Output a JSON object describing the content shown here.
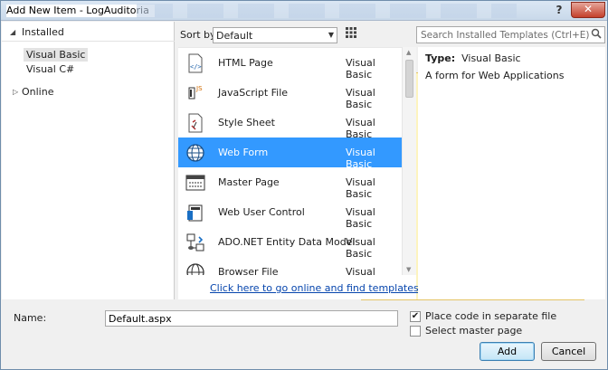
{
  "window": {
    "title": "Add New Item - LogAuditoria",
    "help_glyph": "?",
    "close_glyph": "✕"
  },
  "tree": {
    "installed_label": "Installed",
    "items": [
      {
        "label": "Visual Basic",
        "selected": true
      },
      {
        "label": "Visual C#",
        "selected": false
      }
    ],
    "online_label": "Online"
  },
  "toolbar": {
    "sort_label": "Sort by:",
    "sort_value": "Default"
  },
  "search": {
    "placeholder": "Search Installed Templates (Ctrl+E)"
  },
  "templates": [
    {
      "name": "HTML Page",
      "language": "Visual Basic",
      "icon": "html-page-icon",
      "selected": false
    },
    {
      "name": "JavaScript File",
      "language": "Visual Basic",
      "icon": "javascript-file-icon",
      "selected": false
    },
    {
      "name": "Style Sheet",
      "language": "Visual Basic",
      "icon": "style-sheet-icon",
      "selected": false
    },
    {
      "name": "Web Form",
      "language": "Visual Basic",
      "icon": "web-form-icon",
      "selected": true
    },
    {
      "name": "Master Page",
      "language": "Visual Basic",
      "icon": "master-page-icon",
      "selected": false
    },
    {
      "name": "Web User Control",
      "language": "Visual Basic",
      "icon": "web-user-control-icon",
      "selected": false
    },
    {
      "name": "ADO.NET Entity Data Model",
      "language": "Visual Basic",
      "icon": "entity-data-model-icon",
      "selected": false
    },
    {
      "name": "Browser File",
      "language": "Visual Basic",
      "icon": "browser-file-icon",
      "selected": false
    }
  ],
  "online_link": "Click here to go online and find templates.",
  "details": {
    "type_label": "Type:",
    "type_value": "Visual Basic",
    "description": "A form for Web Applications"
  },
  "bottom": {
    "name_label": "Name:",
    "name_value": "Default.aspx",
    "place_code_label": "Place code in separate file",
    "place_code_checked": true,
    "master_page_label": "Select master page",
    "master_page_checked": false,
    "add_label": "Add",
    "cancel_label": "Cancel"
  },
  "colors": {
    "selection": "#3399ff",
    "link": "#0645ad",
    "accent_blue": "#0a64c8"
  }
}
